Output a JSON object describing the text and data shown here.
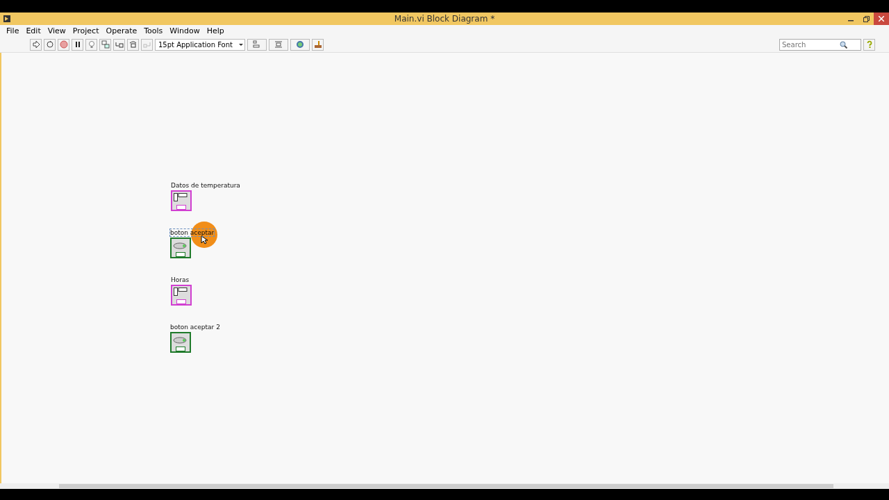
{
  "window": {
    "title": "Main.vi Block Diagram *"
  },
  "menu": [
    "File",
    "Edit",
    "View",
    "Project",
    "Operate",
    "Tools",
    "Window",
    "Help"
  ],
  "toolbar": {
    "font": "15pt Application Font",
    "search": {
      "placeholder": "Search"
    }
  },
  "nodes": [
    {
      "label": "Datos de temperatura",
      "kind": "cluster",
      "selected": false
    },
    {
      "label": "boton aceptar",
      "kind": "boolean",
      "selected": true
    },
    {
      "label": "Horas",
      "kind": "cluster",
      "selected": false
    },
    {
      "label": "boton aceptar 2",
      "kind": "boolean",
      "selected": false
    }
  ]
}
